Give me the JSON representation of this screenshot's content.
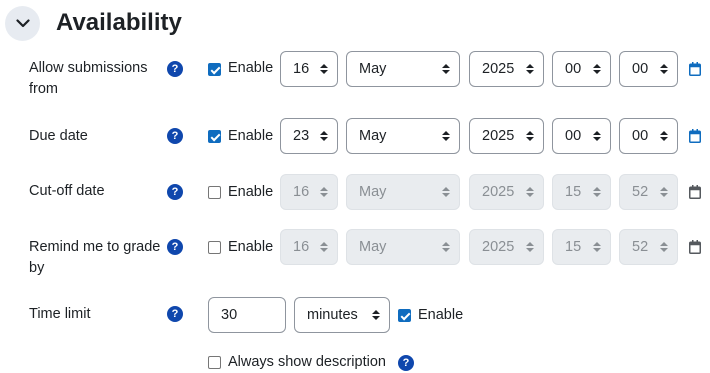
{
  "section": {
    "title": "Availability",
    "toggle_icon": "chevron-down-icon"
  },
  "colors": {
    "accent": "#0f6cbf",
    "help": "#0f47ad",
    "disabled_bg": "#e9ecef"
  },
  "help_glyph": "?",
  "rows": {
    "allow_submissions": {
      "label": "Allow submissions from",
      "enabled": true,
      "enable_label": "Enable",
      "day": "16",
      "month": "May",
      "year": "2025",
      "hour": "00",
      "minute": "00"
    },
    "due_date": {
      "label": "Due date",
      "enabled": true,
      "enable_label": "Enable",
      "day": "23",
      "month": "May",
      "year": "2025",
      "hour": "00",
      "minute": "00"
    },
    "cutoff_date": {
      "label": "Cut-off date",
      "enabled": false,
      "enable_label": "Enable",
      "day": "16",
      "month": "May",
      "year": "2025",
      "hour": "15",
      "minute": "52"
    },
    "remind_grade": {
      "label": "Remind me to grade by",
      "enabled": false,
      "enable_label": "Enable",
      "day": "16",
      "month": "May",
      "year": "2025",
      "hour": "15",
      "minute": "52"
    }
  },
  "time_limit": {
    "label": "Time limit",
    "value": "30",
    "unit": "minutes",
    "enabled": true,
    "enable_label": "Enable"
  },
  "always_show_description": {
    "label": "Always show description",
    "checked": false
  }
}
